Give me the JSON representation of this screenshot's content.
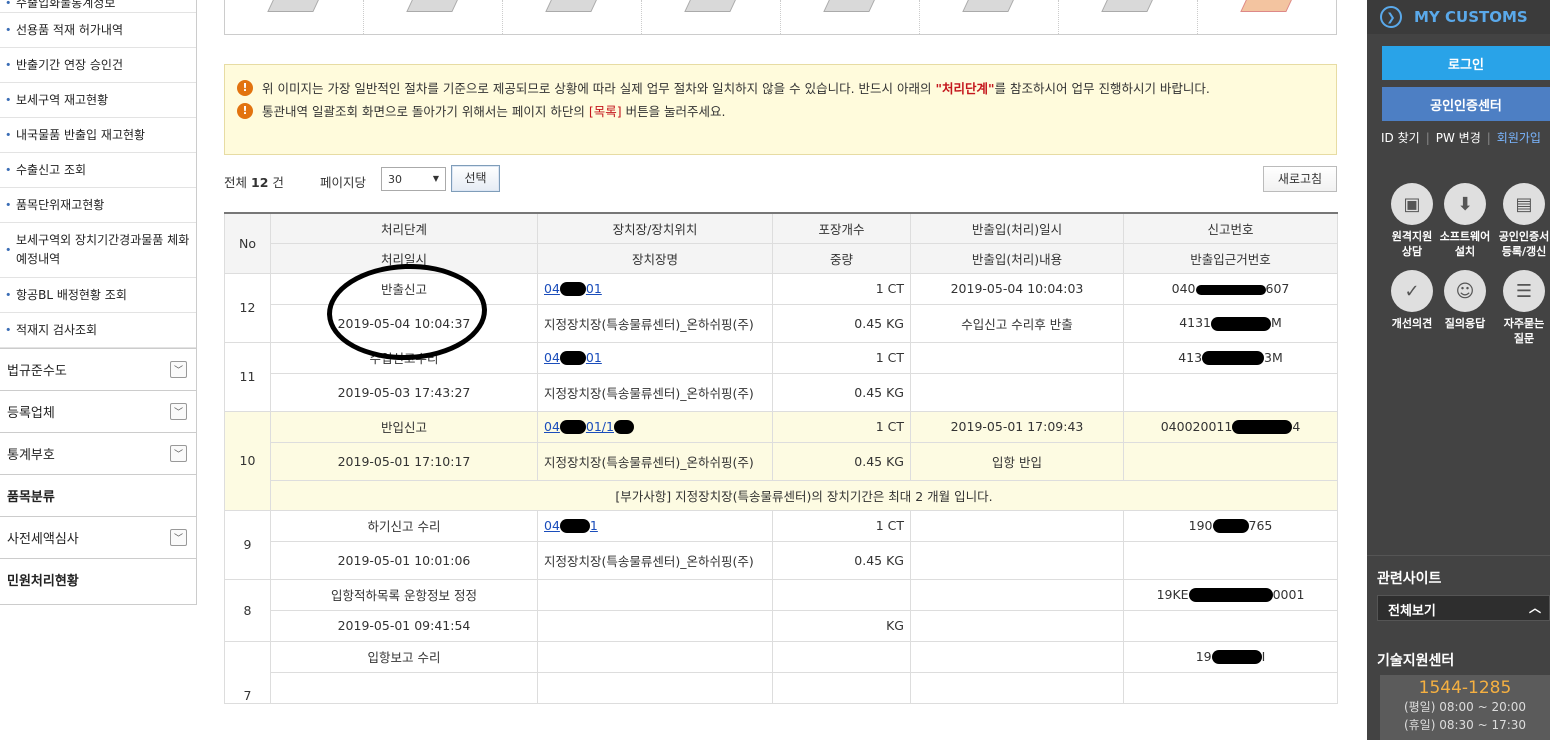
{
  "sidebar": {
    "sub_items": [
      {
        "label": "수출입화물통계정보"
      },
      {
        "label": "선용품 적재 허가내역"
      },
      {
        "label": "반출기간 연장 승인건"
      },
      {
        "label": "보세구역 재고현황"
      },
      {
        "label": "내국물품 반출입 재고현황"
      },
      {
        "label": "수출신고 조회"
      },
      {
        "label": "품목단위재고현황"
      },
      {
        "label": "보세구역외 장치기간경과물품 체화 예정내역"
      },
      {
        "label": "항공BL 배정현황 조회"
      },
      {
        "label": "적재지 검사조회"
      }
    ],
    "menu_items": [
      {
        "label": "법규준수도",
        "toggle": true
      },
      {
        "label": "등록업체",
        "toggle": true
      },
      {
        "label": "통계부호",
        "toggle": true
      },
      {
        "label": "품목분류",
        "toggle": false
      },
      {
        "label": "사전세액심사",
        "toggle": true
      },
      {
        "label": "민원처리현황",
        "toggle": false
      }
    ]
  },
  "notice": {
    "line1_pre": "위 이미지는 가장 일반적인 절차를 기준으로 제공되므로 상황에 따라 실제 업무 절차와 일치하지 않을 수 있습니다. 반드시 아래의 ",
    "line1_highlight": "\"처리단계\"",
    "line1_post": "를 참조하시어 업무 진행하시기 바랍니다.",
    "line2_pre": "통관내역 일괄조회 화면으로 돌아가기 위해서는 페이지 하단의 ",
    "line2_highlight": "[목록]",
    "line2_post": " 버튼을 눌러주세요.",
    "icon": "warning-icon"
  },
  "listbar": {
    "total_prefix": "전체",
    "total_count": "12",
    "total_suffix": "건",
    "per_page_label": "페이지당",
    "per_page_value": "30",
    "select_button": "선택",
    "refresh_button": "새로고침"
  },
  "table": {
    "headers_top": [
      "No",
      "처리단계",
      "장치장/장치위치",
      "포장개수",
      "반출입(처리)일시",
      "신고번호"
    ],
    "headers_bottom": [
      "처리일시",
      "장치장명",
      "중량",
      "반출입(처리)내용",
      "반출입근거번호"
    ],
    "rows": [
      {
        "no": "12",
        "stage": "반출신고",
        "location_code": "04",
        "location_code_tail": "01",
        "packages": "1 CT",
        "io_datetime": "2019-05-04 10:04:03",
        "report_no_pre": "040",
        "report_no_post": "607",
        "processed_at": "2019-05-04 10:04:37",
        "warehouse": "지정장치장(특송물류센터)_온하쉬핑(주)",
        "weight": "0.45 KG",
        "io_content": "수입신고 수리후 반출",
        "basis_no_pre": "4131",
        "basis_no_post": "M"
      },
      {
        "no": "11",
        "stage": "수입신고수리",
        "location_code": "04",
        "location_code_tail": "01",
        "packages": "1 CT",
        "io_datetime": "",
        "report_no_pre": "413",
        "report_no_post": "3M",
        "processed_at": "2019-05-03 17:43:27",
        "warehouse": "지정장치장(특송물류센터)_온하쉬핑(주)",
        "weight": "0.45 KG",
        "io_content": "",
        "basis_no_pre": "",
        "basis_no_post": ""
      },
      {
        "no": "10",
        "stage": "반입신고",
        "location_code": "04",
        "location_code_tail": "01/1",
        "packages": "1 CT",
        "io_datetime": "2019-05-01 17:09:43",
        "report_no_pre": "040020011",
        "report_no_post": "4",
        "processed_at": "2019-05-01 17:10:17",
        "warehouse": "지정장치장(특송물류센터)_온하쉬핑(주)",
        "weight": "0.45 KG",
        "io_content": "입항 반입",
        "basis_no_pre": "",
        "basis_no_post": "",
        "note": "[부가사항] 지정장치장(특송물류센터)의 장치기간은 최대 2 개월 입니다."
      },
      {
        "no": "9",
        "stage": "하기신고 수리",
        "location_code": "04",
        "location_code_tail": "1",
        "packages": "1 CT",
        "io_datetime": "",
        "report_no_pre": "190",
        "report_no_post": "765",
        "processed_at": "2019-05-01 10:01:06",
        "warehouse": "지정장치장(특송물류센터)_온하쉬핑(주)",
        "weight": "0.45 KG",
        "io_content": "",
        "basis_no_pre": "",
        "basis_no_post": ""
      },
      {
        "no": "8",
        "stage": "입항적하목록 운항정보 정정",
        "location_code": "",
        "location_code_tail": "",
        "packages": "",
        "io_datetime": "",
        "report_no_pre": "19KE",
        "report_no_post": "0001",
        "processed_at": "2019-05-01 09:41:54",
        "warehouse": "",
        "weight": "KG",
        "io_content": "",
        "basis_no_pre": "",
        "basis_no_post": ""
      },
      {
        "no": "7",
        "stage": "입항보고 수리",
        "location_code": "",
        "location_code_tail": "",
        "packages": "",
        "io_datetime": "",
        "report_no_pre": "19",
        "report_no_post": "I"
      }
    ]
  },
  "right_panel": {
    "title": "MY CUSTOMS",
    "login_button": "로그인",
    "cert_button": "공인인증센터",
    "links": [
      "ID 찾기",
      "PW 변경",
      "회원가입"
    ],
    "services": [
      {
        "label": "원격지원\n상담",
        "icon": "remote-support-icon"
      },
      {
        "label": "소프트웨어\n설치",
        "icon": "software-install-icon"
      },
      {
        "label": "공인인증서\n등록/갱신",
        "icon": "certificate-icon"
      },
      {
        "label": "개선의견",
        "icon": "feedback-icon"
      },
      {
        "label": "질의응답",
        "icon": "qna-icon"
      },
      {
        "label": "자주묻는\n질문",
        "icon": "faq-icon"
      }
    ],
    "related_sites_title": "관련사이트",
    "related_sites_value": "전체보기",
    "tech_center_title": "기술지원센터",
    "tech_phone": "1544-1285",
    "tech_weekday": "(평일) 08:00 ~ 20:00",
    "tech_holiday": "(휴일) 08:30 ~ 17:30"
  }
}
